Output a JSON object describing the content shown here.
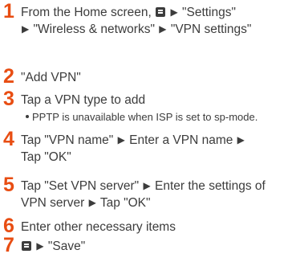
{
  "steps": [
    {
      "num": "1",
      "t1": "From the Home screen,",
      "t2": "\"Settings\"",
      "t3": "\"Wireless & networks\"",
      "t4": "\"VPN settings\""
    },
    {
      "num": "2",
      "t1": "\"Add VPN\""
    },
    {
      "num": "3",
      "t1": "Tap a VPN type to add",
      "note": "PPTP is unavailable when ISP is set to sp-mode."
    },
    {
      "num": "4",
      "t1": "Tap \"VPN name\"",
      "t2": "Enter a VPN name",
      "t3": "Tap \"OK\""
    },
    {
      "num": "5",
      "t1": "Tap \"Set VPN server\"",
      "t2": "Enter the settings of VPN server",
      "t3": "Tap \"OK\""
    },
    {
      "num": "6",
      "t1": "Enter other necessary items"
    },
    {
      "num": "7",
      "t2": "\"Save\""
    }
  ],
  "icons": {
    "menu": "menu-key-icon",
    "arrow": "arrow-right-icon"
  },
  "colors": {
    "step_number": "#e84d12",
    "text": "#3c3c3c"
  }
}
